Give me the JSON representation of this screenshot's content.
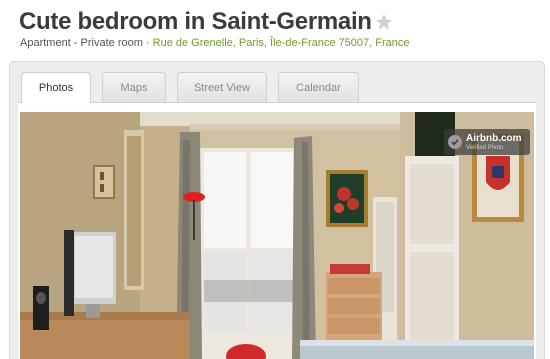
{
  "listing": {
    "title": "Cute bedroom in Saint-Germain",
    "room_type": "Apartment - Private room",
    "separator": " · ",
    "address": "Rue de Grenelle, Paris, Île-de-France 75007, France"
  },
  "tabs": [
    {
      "label": "Photos",
      "active": true
    },
    {
      "label": "Maps",
      "active": false
    },
    {
      "label": "Street View",
      "active": false
    },
    {
      "label": "Calendar",
      "active": false
    }
  ],
  "photo": {
    "watermark_brand": "Airbnb.com",
    "watermark_sub": "Verified Photo"
  },
  "colors": {
    "title": "#393c3d",
    "address_link": "#6f9c2a",
    "star": "#c8c8c8"
  },
  "icons": {
    "favorite": "star-icon",
    "verified": "check-icon"
  }
}
